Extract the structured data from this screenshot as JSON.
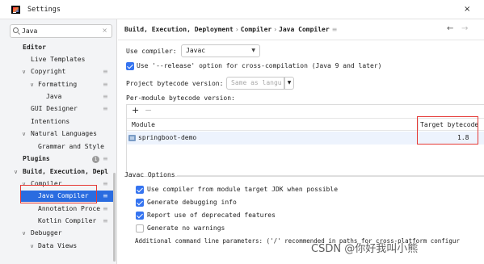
{
  "window": {
    "title": "Settings",
    "close_glyph": "×"
  },
  "sidebar": {
    "search": {
      "value": "Java",
      "clear_glyph": "×"
    },
    "items": [
      {
        "label": "Editor"
      },
      {
        "label": "Live Templates"
      },
      {
        "label": "Copyright"
      },
      {
        "label": "Formatting"
      },
      {
        "label": "Java"
      },
      {
        "label": "GUI Designer"
      },
      {
        "label": "Intentions"
      },
      {
        "label": "Natural Languages"
      },
      {
        "label": "Grammar and Style"
      },
      {
        "label": "Plugins",
        "badge": "1"
      },
      {
        "label": "Build, Execution, Depl"
      },
      {
        "label": "Compiler"
      },
      {
        "label": "Java Compiler"
      },
      {
        "label": "Annotation Proce"
      },
      {
        "label": "Kotlin Compiler"
      },
      {
        "label": "Debugger"
      },
      {
        "label": "Data Views"
      }
    ]
  },
  "breadcrumb": {
    "parts": [
      "Build, Execution, Deployment",
      "Compiler",
      "Java Compiler"
    ],
    "separator": "›"
  },
  "nav": {
    "back": "←",
    "forward": "→"
  },
  "compiler": {
    "label": "Use compiler:",
    "value": "Javac",
    "release_option": "Use '--release' option for cross-compilation (Java 9 and later)",
    "release_checked": true,
    "project_bytecode_label": "Project bytecode version:",
    "project_bytecode_placeholder": "Same as langu",
    "per_module_label": "Per-module bytecode version:"
  },
  "module_table": {
    "toolbar": {
      "add": "+",
      "remove": "−"
    },
    "columns": [
      "Module",
      "Target bytecode"
    ],
    "rows": [
      {
        "module": "springboot-demo",
        "target": "1.8"
      }
    ]
  },
  "javac_options": {
    "title": "Javac Options",
    "options": [
      {
        "label": "Use compiler from module target JDK when possible",
        "checked": true
      },
      {
        "label": "Generate debugging info",
        "checked": true
      },
      {
        "label": "Report use of deprecated features",
        "checked": true
      },
      {
        "label": "Generate no warnings",
        "checked": false
      }
    ],
    "additional_params": "Additional command line parameters:  ('/' recommended in paths for cross-platform configur"
  },
  "watermark": "CSDN @你好我叫小熊",
  "colors": {
    "selection": "#2a6ce0",
    "checkbox": "#3574f0",
    "annotation": "#e53935"
  }
}
